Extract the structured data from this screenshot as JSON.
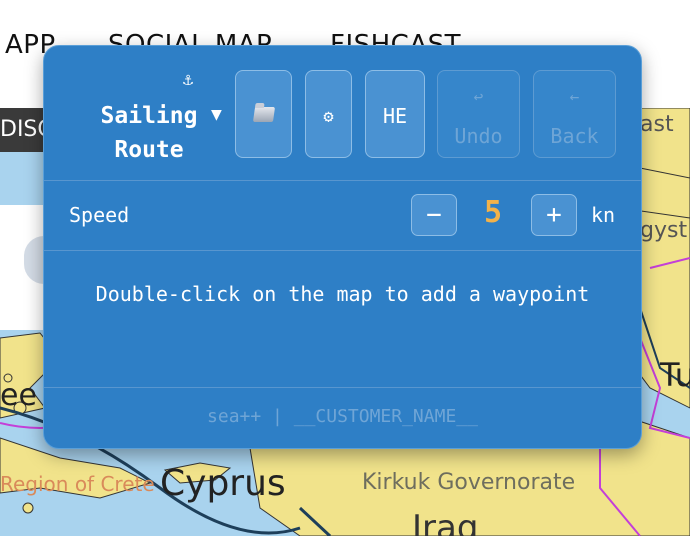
{
  "background": {
    "nav": [
      "APP",
      "SOCIAL MAP",
      "FISHCAST"
    ],
    "discover_tab": "DISCO",
    "map_labels": {
      "cyprus": "Cyprus",
      "crete": "Region of Crete",
      "kirkuk": "Kirkuk Governorate",
      "iraq": "Iraq",
      "east": "ast",
      "gyst": "gyst",
      "tu": "Tu",
      "ee": "ee",
      "sub": "Tu"
    }
  },
  "panel": {
    "anchor_icon": "⚓",
    "title_line1": "Sailing",
    "title_line2": "Route",
    "title_dropdown_icon": "▼",
    "buttons": {
      "settings_icon": "⚙",
      "language": "HE",
      "undo_icon": "↩",
      "undo": "Undo",
      "back_icon": "←",
      "back": "Back"
    },
    "speed": {
      "label": "Speed",
      "minus": "−",
      "value": "5",
      "plus": "+",
      "unit": "kn"
    },
    "message": "Double-click on the map to add a waypoint",
    "footer": "sea++ | __CUSTOMER_NAME__"
  },
  "colors": {
    "panel": "#2e7fc6",
    "speed_value": "#f2b24a",
    "sea": "#a9d3ee",
    "land": "#f1e38b",
    "border_line": "#c43fd8"
  }
}
